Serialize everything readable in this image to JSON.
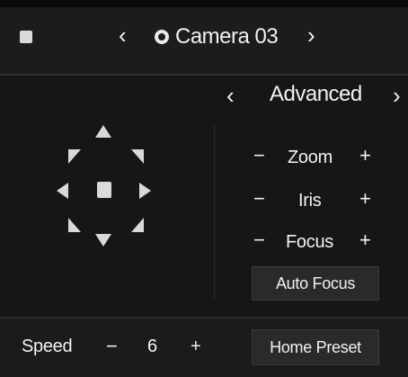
{
  "header": {
    "camera_title": "Camera 03",
    "prev_glyph": "‹",
    "next_glyph": "›",
    "square_icon": "square-icon",
    "camera_icon": "camera-icon"
  },
  "advanced": {
    "title": "Advanced",
    "prev_glyph": "‹",
    "next_glyph": "›"
  },
  "controls": {
    "zoom": {
      "label": "Zoom",
      "minus": "−",
      "plus": "+"
    },
    "iris": {
      "label": "Iris",
      "minus": "−",
      "plus": "+"
    },
    "focus": {
      "label": "Focus",
      "minus": "−",
      "plus": "+"
    },
    "auto_focus": "Auto Focus"
  },
  "speed": {
    "label": "Speed",
    "minus": "−",
    "value": "6",
    "plus": "+"
  },
  "home_preset": "Home Preset",
  "ptz_pad": {
    "icons": [
      "up-arrow-icon",
      "down-arrow-icon",
      "left-arrow-icon",
      "right-arrow-icon",
      "up-left-arrow-icon",
      "up-right-arrow-icon",
      "down-left-arrow-icon",
      "down-right-arrow-icon",
      "center-stop-icon"
    ]
  },
  "colors": {
    "background": "#141414",
    "panel": "#1c1c1c",
    "text": "#f2f2f2",
    "button": "#2a2a2a"
  }
}
